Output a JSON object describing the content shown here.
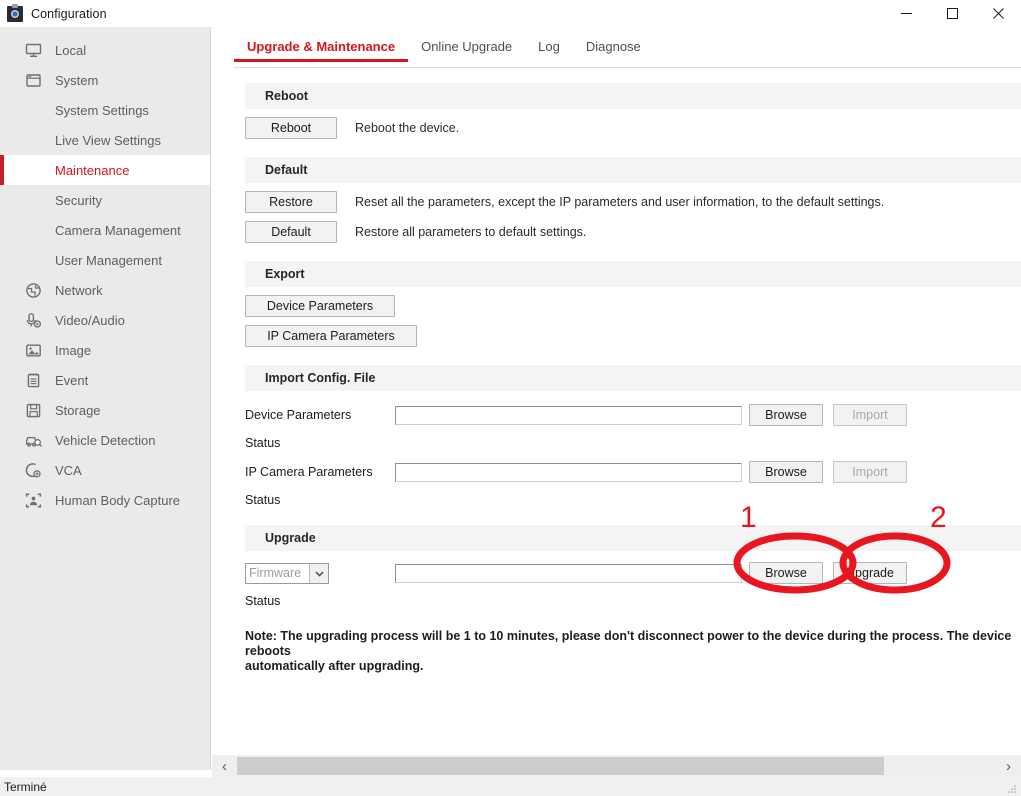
{
  "window": {
    "title": "Configuration",
    "icon": "camera-icon",
    "controls": {
      "minimize": "minimize-icon",
      "maximize": "maximize-icon",
      "close": "close-icon"
    }
  },
  "sidebar": {
    "items": [
      {
        "label": "Local",
        "icon": "monitor-icon",
        "level": "top",
        "active": false
      },
      {
        "label": "System",
        "icon": "window-icon",
        "level": "top",
        "active": false
      },
      {
        "label": "System Settings",
        "icon": "",
        "level": "sub",
        "active": false
      },
      {
        "label": "Live View Settings",
        "icon": "",
        "level": "sub",
        "active": false
      },
      {
        "label": "Maintenance",
        "icon": "",
        "level": "sub",
        "active": true
      },
      {
        "label": "Security",
        "icon": "",
        "level": "sub",
        "active": false
      },
      {
        "label": "Camera Management",
        "icon": "",
        "level": "sub",
        "active": false
      },
      {
        "label": "User Management",
        "icon": "",
        "level": "sub",
        "active": false
      },
      {
        "label": "Network",
        "icon": "globe-icon",
        "level": "top",
        "active": false
      },
      {
        "label": "Video/Audio",
        "icon": "microphone-icon",
        "level": "top",
        "active": false
      },
      {
        "label": "Image",
        "icon": "picture-icon",
        "level": "top",
        "active": false
      },
      {
        "label": "Event",
        "icon": "clipboard-icon",
        "level": "top",
        "active": false
      },
      {
        "label": "Storage",
        "icon": "floppy-disk-icon",
        "level": "top",
        "active": false
      },
      {
        "label": "Vehicle Detection",
        "icon": "car-search-icon",
        "level": "top",
        "active": false
      },
      {
        "label": "VCA",
        "icon": "vca-icon",
        "level": "top",
        "active": false
      },
      {
        "label": "Human Body Capture",
        "icon": "person-frame-icon",
        "level": "top",
        "active": false
      }
    ]
  },
  "tabs": [
    {
      "label": "Upgrade & Maintenance",
      "active": true
    },
    {
      "label": "Online Upgrade",
      "active": false
    },
    {
      "label": "Log",
      "active": false
    },
    {
      "label": "Diagnose",
      "active": false
    }
  ],
  "sections": {
    "reboot": {
      "heading": "Reboot",
      "button": "Reboot",
      "description": "Reboot the device."
    },
    "default": {
      "heading": "Default",
      "restore_button": "Restore",
      "restore_description": "Reset all the parameters, except the IP parameters and user information, to the default settings.",
      "default_button": "Default",
      "default_description": "Restore all parameters to default settings."
    },
    "export": {
      "heading": "Export",
      "device_params_button": "Device Parameters",
      "ip_camera_params_button": "IP Camera Parameters"
    },
    "import": {
      "heading": "Import Config. File",
      "device_params_label": "Device Parameters",
      "device_params_value": "",
      "device_params_browse": "Browse",
      "device_params_import": "Import",
      "device_params_status_label": "Status",
      "device_params_status_value": "",
      "ip_camera_params_label": "IP Camera Parameters",
      "ip_camera_params_value": "",
      "ip_camera_params_browse": "Browse",
      "ip_camera_params_import": "Import",
      "ip_camera_params_status_label": "Status",
      "ip_camera_params_status_value": ""
    },
    "upgrade": {
      "heading": "Upgrade",
      "type_selected": "Firmware",
      "file_value": "",
      "browse_button": "Browse",
      "upgrade_button": "Upgrade",
      "status_label": "Status",
      "status_value": "",
      "note": "Note: The upgrading process will be 1 to 10 minutes, please don't disconnect power to the device during the process. The device reboots\nautomatically after upgrading."
    }
  },
  "annotations": {
    "color": "#e8161f",
    "markers": [
      {
        "number": "1",
        "target": "upgrade-browse-button"
      },
      {
        "number": "2",
        "target": "upgrade-upgrade-button"
      }
    ]
  },
  "scrollbar": {
    "left_arrow": "‹",
    "right_arrow": "›"
  },
  "statusbar": {
    "text": "Terminé"
  }
}
